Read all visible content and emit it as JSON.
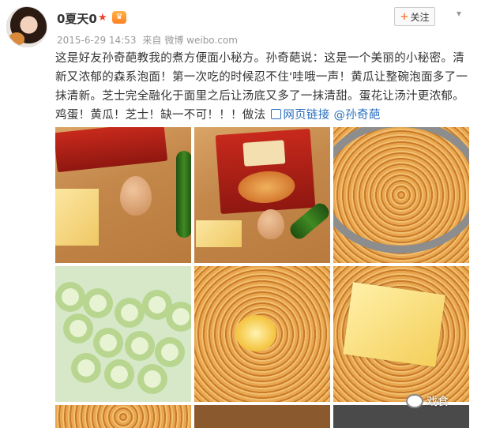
{
  "post": {
    "username": "0夏天0",
    "timestamp": "2015-6-29 14:53",
    "source_prefix": "来自",
    "source": "微博 weibo.com",
    "follow_label": "关注",
    "text": "这是好友孙奇葩教我的煮方便面小秘方。孙奇葩说：这是一个美丽的小秘密。清新又浓郁的森系泡面！第一次吃的时候忍不住'哇哦一声！黄瓜让整碗泡面多了一抹清新。芝士完全融化于面里之后让汤底又多了一抹清甜。蛋花让汤汁更浓郁。鸡蛋！黄瓜！芝士！缺一不可！！！做法",
    "link_label": "网页链接",
    "mention": "@孙奇葩"
  },
  "watermark": {
    "text": "戏食"
  },
  "icons": {
    "verified": "star-verified-icon",
    "vip": "vip-crown-icon",
    "chevron": "chevron-down-icon",
    "link": "web-link-icon"
  },
  "colors": {
    "link": "#2a6fbf",
    "accent": "#ff8140",
    "meta": "#999999"
  }
}
